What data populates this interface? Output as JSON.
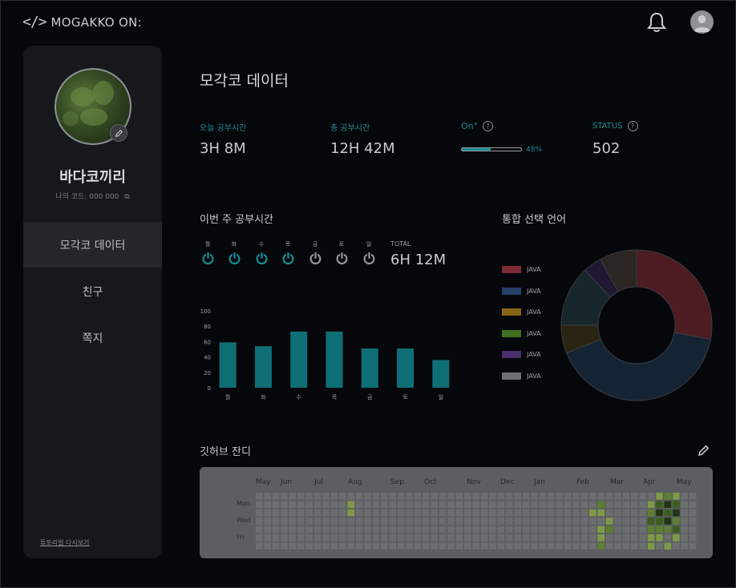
{
  "app": {
    "logo_mark": "</>",
    "logo_text": "MOGAKKO ON:"
  },
  "header": {
    "notification_icon": "bell-icon",
    "profile_icon": "user-avatar-icon"
  },
  "sidebar": {
    "nickname": "바다코끼리",
    "code_label": "나의 코드: 000 000",
    "nav": [
      {
        "label": "모각코 데이터",
        "active": true
      },
      {
        "label": "친구",
        "active": false
      },
      {
        "label": "쪽지",
        "active": false
      }
    ],
    "tutorial_link": "튜토리얼 다시보기"
  },
  "main": {
    "title": "모각코 데이터",
    "stats": {
      "today": {
        "label": "오늘 공부시간",
        "value": "3H 8M"
      },
      "total": {
        "label": "총 공부시간",
        "value": "12H 42M"
      },
      "on": {
        "label": "On°",
        "percent_label": "48%",
        "percent": 48
      },
      "status": {
        "label": "STATUS",
        "value": "502"
      }
    },
    "weekly": {
      "title": "이번 주 공부시간",
      "days": [
        {
          "label": "월",
          "active": true
        },
        {
          "label": "화",
          "active": true
        },
        {
          "label": "수",
          "active": true
        },
        {
          "label": "목",
          "active": true
        },
        {
          "label": "금",
          "active": false
        },
        {
          "label": "토",
          "active": false
        },
        {
          "label": "일",
          "active": false
        }
      ],
      "total_label": "TOTAL",
      "total_value": "6H 12M"
    },
    "languages": {
      "title": "통합 선택 언어",
      "items": [
        {
          "label": "JAVA",
          "color": "#7a2a33"
        },
        {
          "label": "JAVA",
          "color": "#25406b"
        },
        {
          "label": "JAVA",
          "color": "#8a6418"
        },
        {
          "label": "JAVA",
          "color": "#3f6e1e"
        },
        {
          "label": "JAVA",
          "color": "#4b2e6b"
        },
        {
          "label": "JAVA",
          "color": "#707070"
        }
      ]
    },
    "grass": {
      "title": "깃허브 잔디",
      "months": [
        "May",
        "Jun",
        "Jul",
        "Aug",
        "Sep",
        "Oct",
        "Nov",
        "Dec",
        "Jan",
        "Feb",
        "Mar",
        "Apr",
        "May"
      ],
      "weekdays": [
        "Mon",
        "Wed",
        "Fri"
      ]
    }
  },
  "chart_data": {
    "type": "bar",
    "categories": [
      "월",
      "화",
      "수",
      "목",
      "금",
      "토",
      "일"
    ],
    "values": [
      59,
      54,
      73,
      73,
      51,
      51,
      36
    ],
    "ylim": [
      0,
      100
    ],
    "yticks": [
      0,
      20,
      40,
      60,
      80,
      100
    ],
    "bar_color": "#0f6f76"
  },
  "donut_data": {
    "type": "pie",
    "series": [
      {
        "color": "#4d1b22",
        "value": 28
      },
      {
        "color": "#152433",
        "value": 41
      },
      {
        "color": "#2a2413",
        "value": 6
      },
      {
        "color": "#17262a",
        "value": 13
      },
      {
        "color": "#1f1830",
        "value": 4
      },
      {
        "color": "#2b2624",
        "value": 8
      }
    ]
  }
}
